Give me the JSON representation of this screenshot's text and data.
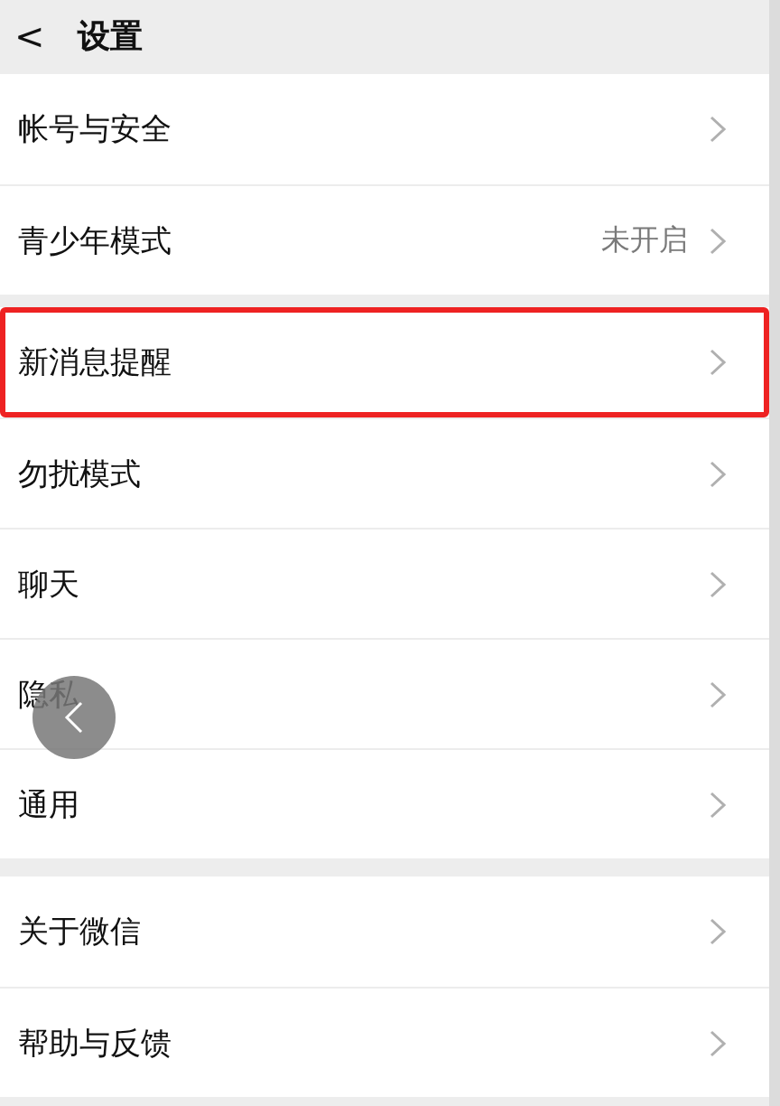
{
  "header": {
    "back": "<",
    "title": "设置"
  },
  "groups": [
    {
      "items": [
        {
          "label": "帐号与安全",
          "highlighted": false
        },
        {
          "label": "青少年模式",
          "value": "未开启",
          "highlighted": false
        }
      ]
    },
    {
      "items": [
        {
          "label": "新消息提醒",
          "highlighted": true
        },
        {
          "label": "勿扰模式",
          "highlighted": false
        },
        {
          "label": "聊天",
          "highlighted": false
        },
        {
          "label": "隐私",
          "highlighted": false
        },
        {
          "label": "通用",
          "highlighted": false
        }
      ]
    },
    {
      "items": [
        {
          "label": "关于微信",
          "highlighted": false
        },
        {
          "label": "帮助与反馈",
          "highlighted": false
        }
      ]
    }
  ],
  "floating_button": {
    "visible": true
  }
}
